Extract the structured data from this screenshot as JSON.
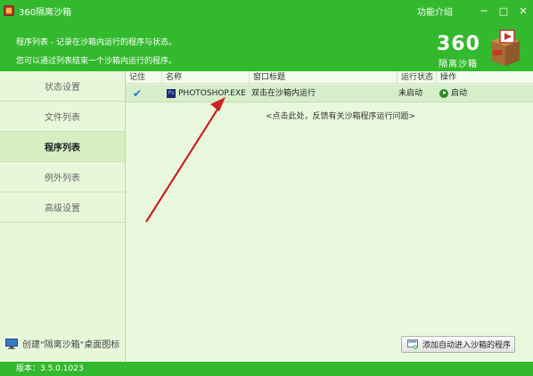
{
  "window": {
    "title": "360隔离沙箱",
    "func_intro": "功能介绍",
    "minimize": "─",
    "maximize": "□",
    "close": "✕"
  },
  "banner": {
    "line1": "程序列表 - 记录在沙箱内运行的程序与状态。",
    "line2": "您可以通过列表结束一个沙箱内运行的程序。",
    "logo_number": "360",
    "logo_text": "隔离沙箱"
  },
  "sidebar": {
    "items": [
      {
        "label": "状态设置",
        "active": false
      },
      {
        "label": "文件列表",
        "active": false
      },
      {
        "label": "程序列表",
        "active": true
      },
      {
        "label": "例外列表",
        "active": false
      },
      {
        "label": "高级设置",
        "active": false
      }
    ],
    "desktop_shortcut": "创建\"隔离沙箱\"桌面图标"
  },
  "table": {
    "columns": [
      "记住",
      "名称",
      "窗口标题",
      "运行状态",
      "操作"
    ],
    "rows": [
      {
        "remember": "✔",
        "name": "PHOTOSHOP.EXE",
        "window_title": "双击在沙箱内运行",
        "status": "未启动",
        "action": "启动"
      }
    ],
    "feedback": "<点击此处，反馈有关沙箱程序运行问题>"
  },
  "add_button": "添加自动进入沙箱的程序",
  "statusbar": "版本：3.5.0.1023",
  "colors": {
    "brand_green": "#33b92d",
    "panel_bg": "#e9f8dc",
    "arrow": "#cc2222"
  }
}
